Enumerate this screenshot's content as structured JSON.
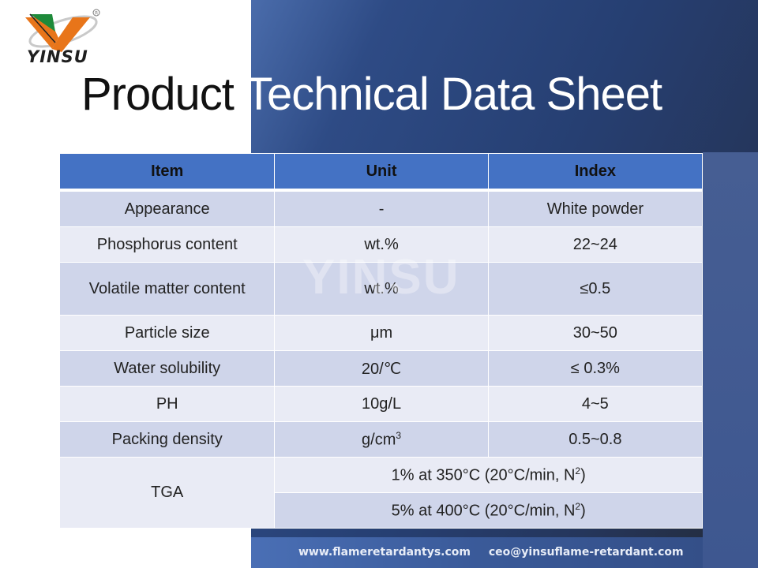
{
  "brand": {
    "name": "YINSU",
    "colors": {
      "green": "#1e8a3a",
      "orange": "#e8751a",
      "panel_blue": "#2e4b85",
      "header_blue": "#4472c4",
      "row_odd": "#cfd5ea",
      "row_even": "#e9ebf5"
    }
  },
  "title": {
    "dark_part": "Product",
    "light_part": "Technical Data Sheet"
  },
  "watermark": "YINSU",
  "table": {
    "headers": [
      "Item",
      "Unit",
      "Index"
    ],
    "rows": [
      {
        "item": "Appearance",
        "unit": "-",
        "index": "White powder"
      },
      {
        "item": "Phosphorus content",
        "unit": "wt.%",
        "index": "22~24"
      },
      {
        "item": "Volatile matter content",
        "unit": "wt.%",
        "index": "≤0.5"
      },
      {
        "item": "Particle size",
        "unit": "μm",
        "index": "30~50"
      },
      {
        "item": "Water solubility",
        "unit": "20/℃",
        "index": "≤ 0.3%"
      },
      {
        "item": "PH",
        "unit": "10g/L",
        "index": "4~5"
      },
      {
        "item": "Packing density",
        "unit_base": "g/cm",
        "unit_sup": "3",
        "index": "0.5~0.8"
      }
    ],
    "tga": {
      "item": "TGA",
      "lines": [
        {
          "text": "1% at 350°C (20°C/min, N",
          "sup": "2",
          "close": ")"
        },
        {
          "text": "5% at 400°C (20°C/min, N",
          "sup": "2",
          "close": ")"
        }
      ]
    }
  },
  "footer": {
    "website": "www.flameretardantys.com",
    "email": "ceo@yinsuflame-retardant.com"
  }
}
